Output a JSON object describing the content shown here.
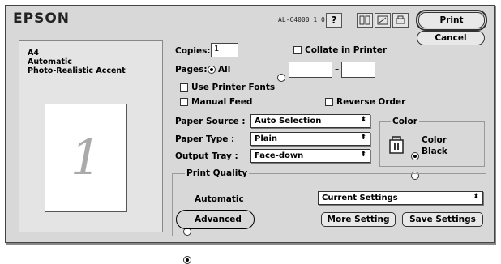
{
  "brand": "EPSON",
  "model": "AL-C4000 1.0",
  "header_buttons": {
    "help": "?",
    "print": "Print",
    "cancel": "Cancel"
  },
  "summary": {
    "paper_size": "A4",
    "mode": "Automatic",
    "setting": "Photo-Realistic Accent"
  },
  "preview_page_number": "1",
  "copies": {
    "label": "Copies:",
    "value": "1"
  },
  "collate": {
    "label": "Collate in Printer",
    "checked": false
  },
  "pages": {
    "label": "Pages:",
    "all_label": "All",
    "selected": "All",
    "from": "",
    "to": "",
    "dash": "–"
  },
  "use_printer_fonts": {
    "label": "Use Printer Fonts",
    "checked": false
  },
  "manual_feed": {
    "label": "Manual Feed",
    "checked": false
  },
  "reverse_order": {
    "label": "Reverse Order",
    "checked": false
  },
  "paper_source": {
    "label": "Paper Source :",
    "value": "Auto Selection"
  },
  "paper_type": {
    "label": "Paper Type :",
    "value": "Plain"
  },
  "output_tray": {
    "label": "Output Tray :",
    "value": "Face-down"
  },
  "color_group": {
    "title": "Color",
    "options": [
      "Color",
      "Black"
    ],
    "selected": "Color"
  },
  "print_quality": {
    "title": "Print Quality",
    "options": [
      "Automatic",
      "Advanced"
    ],
    "selected": "Advanced",
    "settings_value": "Current Settings",
    "more_setting": "More Setting",
    "save_settings": "Save Settings"
  }
}
